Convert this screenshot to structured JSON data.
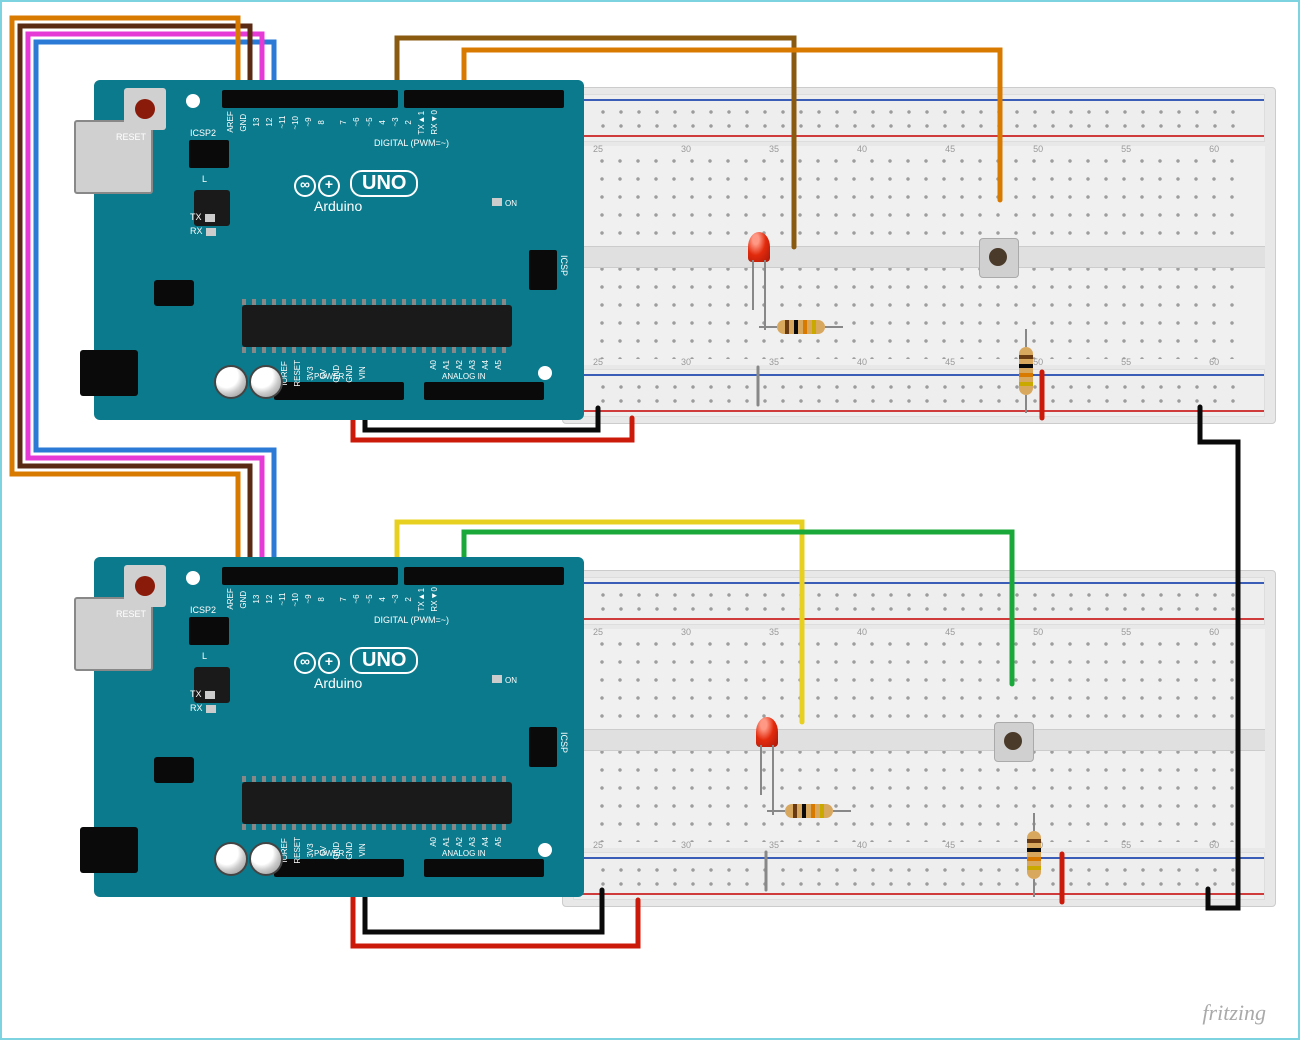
{
  "diagram": {
    "tool": "fritzing",
    "boards": [
      {
        "id": "arduino-top",
        "type": "Arduino UNO",
        "logo": "∞+",
        "uno_label": "UNO",
        "brand": "Arduino",
        "reset": "RESET",
        "icsp2": "ICSP2",
        "icsp": "ICSP",
        "digital_label": "DIGITAL (PWM=~)",
        "power_label": "POWER",
        "analog_label": "ANALOG IN",
        "tx": "TX",
        "rx": "RX",
        "l": "L",
        "on": "ON",
        "digital_pins": [
          "AREF",
          "GND",
          "13",
          "12",
          "~11",
          "~10",
          "~9",
          "8",
          "7",
          "~6",
          "~5",
          "4",
          "~3",
          "2",
          "TX►1",
          "RX◄0"
        ],
        "power_pins": [
          "IOREF",
          "RESET",
          "3V3",
          "5V",
          "GND",
          "GND",
          "VIN"
        ],
        "analog_pins": [
          "A0",
          "A1",
          "A2",
          "A3",
          "A4",
          "A5"
        ]
      },
      {
        "id": "arduino-bottom",
        "type": "Arduino UNO",
        "logo": "∞+",
        "uno_label": "UNO",
        "brand": "Arduino",
        "reset": "RESET",
        "icsp2": "ICSP2",
        "icsp": "ICSP",
        "digital_label": "DIGITAL (PWM=~)",
        "power_label": "POWER",
        "analog_label": "ANALOG IN",
        "tx": "TX",
        "rx": "RX",
        "l": "L",
        "on": "ON",
        "digital_pins": [
          "AREF",
          "GND",
          "13",
          "12",
          "~11",
          "~10",
          "~9",
          "8",
          "7",
          "~6",
          "~5",
          "4",
          "~3",
          "2",
          "TX►1",
          "RX◄0"
        ],
        "power_pins": [
          "IOREF",
          "RESET",
          "3V3",
          "5V",
          "GND",
          "GND",
          "VIN"
        ],
        "analog_pins": [
          "A0",
          "A1",
          "A2",
          "A3",
          "A4",
          "A5"
        ]
      }
    ],
    "breadboards": [
      {
        "id": "bb-top",
        "cols_visible": [
          25,
          30,
          35,
          40,
          45,
          50,
          55,
          60
        ]
      },
      {
        "id": "bb-bottom",
        "cols_visible": [
          25,
          30,
          35,
          40,
          45,
          50,
          55,
          60
        ]
      }
    ],
    "components": [
      {
        "id": "led-top",
        "type": "LED",
        "color": "red",
        "board": "bb-top"
      },
      {
        "id": "led-bottom",
        "type": "LED",
        "color": "red",
        "board": "bb-bottom"
      },
      {
        "id": "r1-top",
        "type": "Resistor",
        "bands": [
          "brown",
          "black",
          "orange",
          "gold"
        ],
        "board": "bb-top"
      },
      {
        "id": "r2-top",
        "type": "Resistor",
        "bands": [
          "brown",
          "black",
          "orange",
          "gold"
        ],
        "orientation": "vertical",
        "board": "bb-top"
      },
      {
        "id": "r1-bottom",
        "type": "Resistor",
        "bands": [
          "brown",
          "black",
          "orange",
          "gold"
        ],
        "board": "bb-bottom"
      },
      {
        "id": "r2-bottom",
        "type": "Resistor",
        "bands": [
          "brown",
          "black",
          "orange",
          "gold"
        ],
        "orientation": "vertical",
        "board": "bb-bottom"
      },
      {
        "id": "btn-top",
        "type": "PushButton",
        "board": "bb-top"
      },
      {
        "id": "btn-bottom",
        "type": "PushButton",
        "board": "bb-bottom"
      }
    ],
    "wires": [
      {
        "from": "arduino-top.D13",
        "to": "arduino-bottom.D13",
        "color": "#d97a00"
      },
      {
        "from": "arduino-top.D12",
        "to": "arduino-bottom.D12",
        "color": "#5a2a12"
      },
      {
        "from": "arduino-top.D11",
        "to": "arduino-bottom.D11",
        "color": "#e63ad6"
      },
      {
        "from": "arduino-top.D10",
        "to": "arduino-bottom.D10",
        "color": "#2a7ad6"
      },
      {
        "from": "arduino-top.D7",
        "to": "bb-top.led",
        "color": "#8a5a10"
      },
      {
        "from": "arduino-top.D2",
        "to": "bb-top.button",
        "color": "#d97a00"
      },
      {
        "from": "arduino-top.5V",
        "to": "bb-top.rail+",
        "color": "#cc1a0a"
      },
      {
        "from": "arduino-top.GND",
        "to": "bb-top.rail-",
        "color": "#0a0a0a"
      },
      {
        "from": "arduino-bottom.D7",
        "to": "bb-bottom.led",
        "color": "#e8d020"
      },
      {
        "from": "arduino-bottom.D2",
        "to": "bb-bottom.button",
        "color": "#1aa83a"
      },
      {
        "from": "arduino-bottom.5V",
        "to": "bb-bottom.rail+",
        "color": "#cc1a0a"
      },
      {
        "from": "arduino-bottom.GND",
        "to": "bb-bottom.rail-",
        "color": "#0a0a0a"
      },
      {
        "from": "bb-top.rail-",
        "to": "bb-bottom.rail-",
        "color": "#0a0a0a"
      },
      {
        "from": "bb-top.button.rail+",
        "to": "bb-top.button",
        "color": "#cc1a0a"
      },
      {
        "from": "bb-bottom.button.rail+",
        "to": "bb-bottom.button",
        "color": "#cc1a0a"
      }
    ]
  }
}
